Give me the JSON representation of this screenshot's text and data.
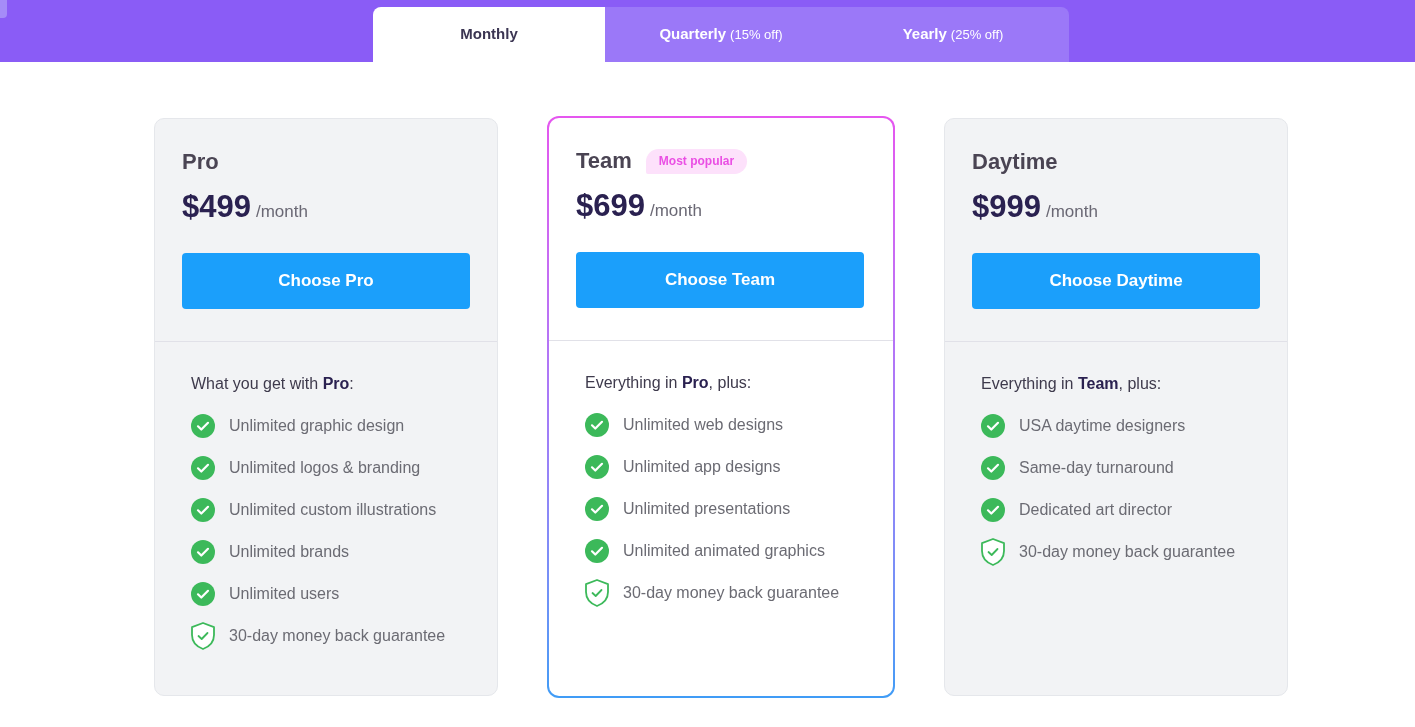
{
  "tabs": [
    {
      "label": "Monthly",
      "selected": true
    },
    {
      "label": "Quarterly",
      "note": "(15% off)",
      "selected": false
    },
    {
      "label": "Yearly",
      "note": "(25% off)",
      "selected": false
    }
  ],
  "plans": [
    {
      "name": "Pro",
      "featured": false,
      "price": "$499",
      "period": "/month",
      "button": "Choose Pro",
      "intro": "What you get with **Pro**:",
      "features": [
        {
          "kind": "check",
          "text": "Unlimited graphic design"
        },
        {
          "kind": "check",
          "text": "Unlimited logos & branding"
        },
        {
          "kind": "check",
          "text": "Unlimited custom illustrations"
        },
        {
          "kind": "check",
          "text": "Unlimited brands"
        },
        {
          "kind": "check",
          "text": "Unlimited users"
        },
        {
          "kind": "shield",
          "text": "30-day money back guarantee"
        }
      ]
    },
    {
      "name": "Team",
      "badge": "Most popular",
      "featured": true,
      "price": "$699",
      "period": "/month",
      "button": "Choose Team",
      "intro": "Everything in **Pro**, plus:",
      "features": [
        {
          "kind": "check",
          "text": "Unlimited web designs"
        },
        {
          "kind": "check",
          "text": "Unlimited app designs"
        },
        {
          "kind": "check",
          "text": "Unlimited presentations"
        },
        {
          "kind": "check",
          "text": "Unlimited animated graphics"
        },
        {
          "kind": "shield",
          "text": "30-day money back guarantee"
        }
      ]
    },
    {
      "name": "Daytime",
      "featured": false,
      "price": "$999",
      "period": "/month",
      "button": "Choose Daytime",
      "intro": "Everything in **Team**, plus:",
      "features": [
        {
          "kind": "check",
          "text": "USA daytime designers"
        },
        {
          "kind": "check",
          "text": "Same-day turnaround"
        },
        {
          "kind": "check",
          "text": "Dedicated art director"
        },
        {
          "kind": "shield",
          "text": "30-day money back guarantee"
        }
      ]
    }
  ]
}
